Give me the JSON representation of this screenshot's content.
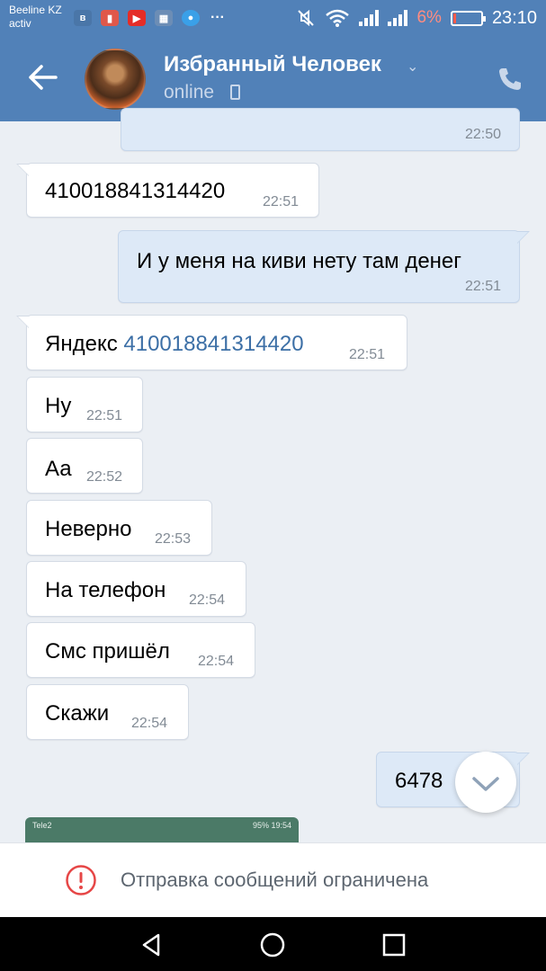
{
  "status": {
    "carrier_line1": "Beeline KZ",
    "carrier_line2": "activ",
    "battery_percent": "6%",
    "time": "23:10",
    "app_icons": [
      "vk-icon",
      "mail-icon",
      "youtube-icon",
      "gallery-icon",
      "messenger-icon",
      "more-icon"
    ]
  },
  "header": {
    "contact_name": "Избранный Человек",
    "presence": "online"
  },
  "messages": [
    {
      "dir": "out",
      "text": "",
      "time": "22:50"
    },
    {
      "dir": "in",
      "prefix": "",
      "link": "410018841314420",
      "time": "22:51"
    },
    {
      "dir": "out",
      "text": "И у меня на киви нету там денег",
      "time": "22:51"
    },
    {
      "dir": "in",
      "prefix": "Яндекс ",
      "link": "410018841314420",
      "time": "22:51"
    },
    {
      "dir": "in",
      "text": "Ну",
      "time": "22:51"
    },
    {
      "dir": "in",
      "text": "Аа",
      "time": "22:52"
    },
    {
      "dir": "in",
      "text": "Неверно",
      "time": "22:53"
    },
    {
      "dir": "in",
      "text": "На телефон",
      "time": "22:54"
    },
    {
      "dir": "in",
      "text": "Смс пришёл",
      "time": "22:54"
    },
    {
      "dir": "in",
      "text": "Скажи",
      "time": "22:54"
    },
    {
      "dir": "out",
      "text": "6478",
      "time": ""
    }
  ],
  "attachment_preview": {
    "left_text": "Tele2",
    "right_text": "95%  19:54"
  },
  "composer": {
    "restriction_text": "Отправка сообщений ограничена"
  },
  "colors": {
    "header": "#5181b8",
    "chat_background": "#ebeff4",
    "incoming_bubble": "#ffffff",
    "outgoing_bubble": "#dde9f7",
    "link": "#3c6fa6",
    "warning": "#e64646"
  }
}
